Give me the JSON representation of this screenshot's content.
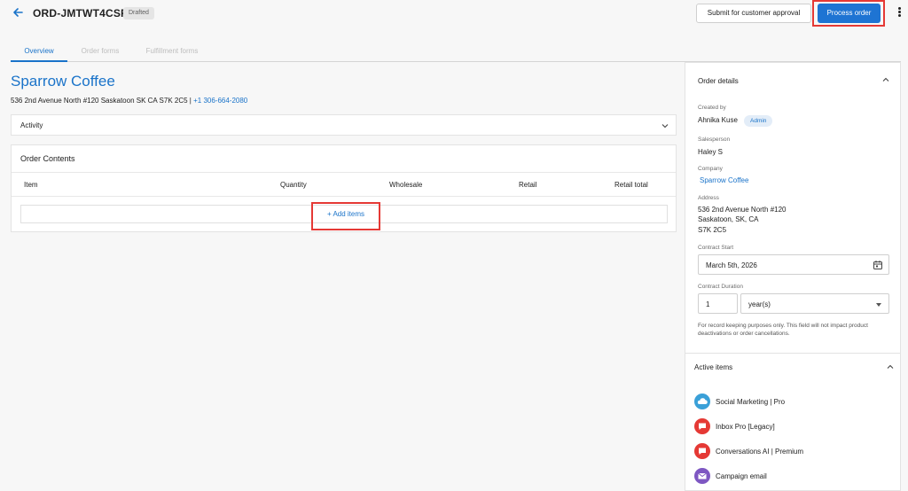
{
  "header": {
    "order_id": "ORD-JMTWT4CSR4",
    "status": "Drafted",
    "submit_label": "Submit for customer approval",
    "process_label": "Process order"
  },
  "tabs": [
    {
      "label": "Overview",
      "active": true
    },
    {
      "label": "Order forms",
      "active": false
    },
    {
      "label": "Fulfillment forms",
      "active": false
    }
  ],
  "company": {
    "name": "Sparrow Coffee",
    "address": "536 2nd Avenue North #120 Saskatoon SK CA S7K 2C5 |",
    "phone": "+1 306-664-2080"
  },
  "activity": {
    "label": "Activity"
  },
  "order_contents": {
    "title": "Order Contents",
    "columns": [
      "Item",
      "Quantity",
      "Wholesale",
      "Retail",
      "Retail total"
    ],
    "add_items_label": "+ Add items"
  },
  "order_details": {
    "title": "Order details",
    "created_by_label": "Created by",
    "created_by": "Ahnika Kuse",
    "role_badge": "Admin",
    "salesperson_label": "Salesperson",
    "salesperson": "Haley S",
    "company_label": "Company",
    "company": "Sparrow Coffee",
    "address_label": "Address",
    "address_lines": [
      "536 2nd Avenue North #120",
      "Saskatoon, SK, CA",
      "S7K 2C5"
    ],
    "contract_start_label": "Contract Start",
    "contract_start": "March 5th, 2026",
    "contract_duration_label": "Contract Duration",
    "duration_value": "1",
    "duration_unit": "year(s)",
    "hint": "For record keeping purposes only. This field will not impact product deactivations or order cancellations."
  },
  "active_items": {
    "title": "Active items",
    "items": [
      {
        "label": "Social Marketing | Pro",
        "color": "#3aa0d8",
        "icon": "cloud-icon"
      },
      {
        "label": "Inbox Pro [Legacy]",
        "color": "#e53935",
        "icon": "chat-icon"
      },
      {
        "label": "Conversations AI | Premium",
        "color": "#e53935",
        "icon": "chat-icon"
      },
      {
        "label": "Campaign email",
        "color": "#7e57c2",
        "icon": "email-icon"
      }
    ]
  },
  "colors": {
    "accent": "#1a73c9",
    "primary_button": "#1e74d3",
    "highlight": "#e53935"
  }
}
